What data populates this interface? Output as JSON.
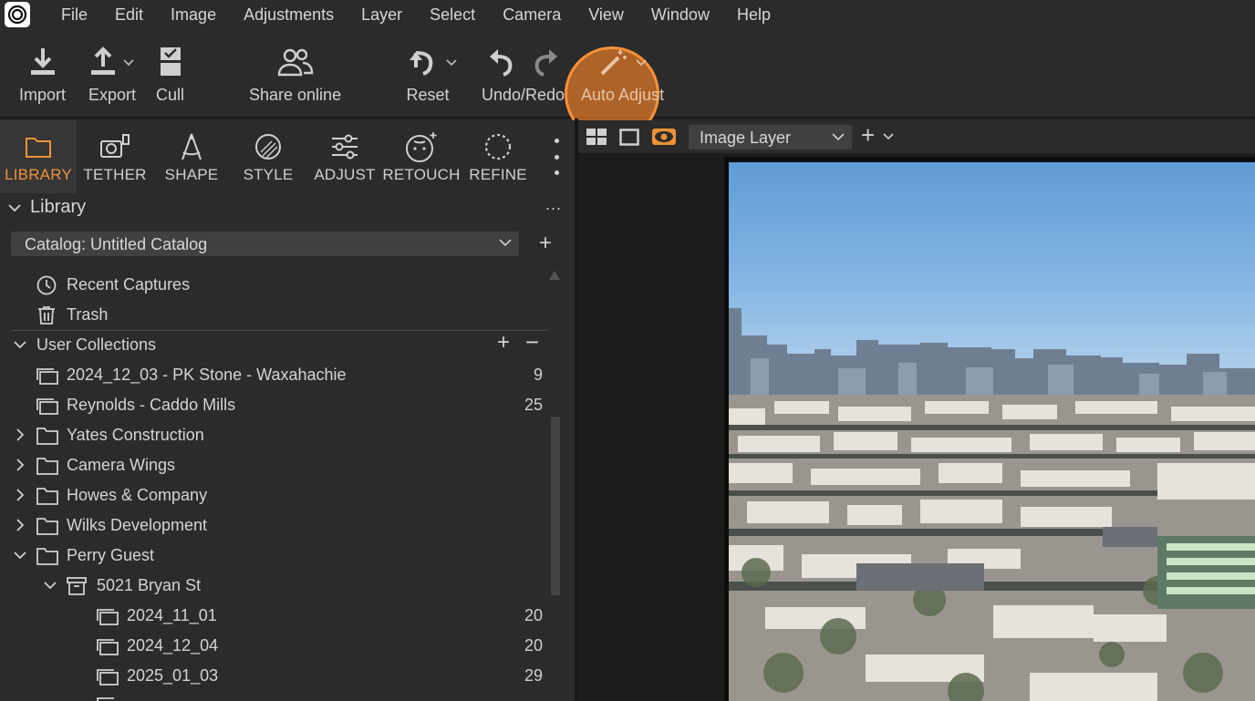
{
  "menubar": {
    "logo_icon": "capture-one-logo-icon",
    "items": [
      "File",
      "Edit",
      "Image",
      "Adjustments",
      "Layer",
      "Select",
      "Camera",
      "View",
      "Window",
      "Help"
    ]
  },
  "toolbar": {
    "import_label": "Import",
    "export_label": "Export",
    "cull_label": "Cull",
    "share_label": "Share online",
    "reset_label": "Reset",
    "undo_redo_label": "Undo/Redo",
    "auto_adjust_label": "Auto Adjust",
    "highlight_color": "#f7913a"
  },
  "tool_tabs": [
    {
      "label": "LIBRARY",
      "icon": "folder-icon",
      "active": true
    },
    {
      "label": "TETHER",
      "icon": "tether-camera-icon"
    },
    {
      "label": "SHAPE",
      "icon": "shape-compass-icon"
    },
    {
      "label": "STYLE",
      "icon": "style-palette-icon"
    },
    {
      "label": "ADJUST",
      "icon": "adjust-sliders-icon"
    },
    {
      "label": "RETOUCH",
      "icon": "retouch-face-icon"
    },
    {
      "label": "REFINE",
      "icon": "refine-circle-icon"
    }
  ],
  "library": {
    "title": "Library",
    "more": "...",
    "catalog": "Catalog: Untitled Catalog",
    "recent_captures": "Recent Captures",
    "trash": "Trash",
    "user_collections": "User Collections",
    "collections": [
      {
        "label": "2024_12_03 - PK Stone - Waxahachie",
        "count": "9"
      },
      {
        "label": "Reynolds - Caddo Mills",
        "count": "25"
      },
      {
        "label": "Yates Construction"
      },
      {
        "label": "Camera Wings"
      },
      {
        "label": "Howes & Company"
      },
      {
        "label": "Wilks Development"
      },
      {
        "label": "Perry Guest"
      },
      {
        "label": "5021 Bryan St"
      },
      {
        "label": "2024_11_01",
        "count": "20"
      },
      {
        "label": "2024_12_04",
        "count": "20"
      },
      {
        "label": "2025_01_03",
        "count": "29"
      }
    ]
  },
  "viewer": {
    "layer_select": "Image Layer"
  },
  "colors": {
    "accent": "#f09238",
    "panel_bg": "#2b2b2b",
    "active_tab_bg": "#363636"
  }
}
